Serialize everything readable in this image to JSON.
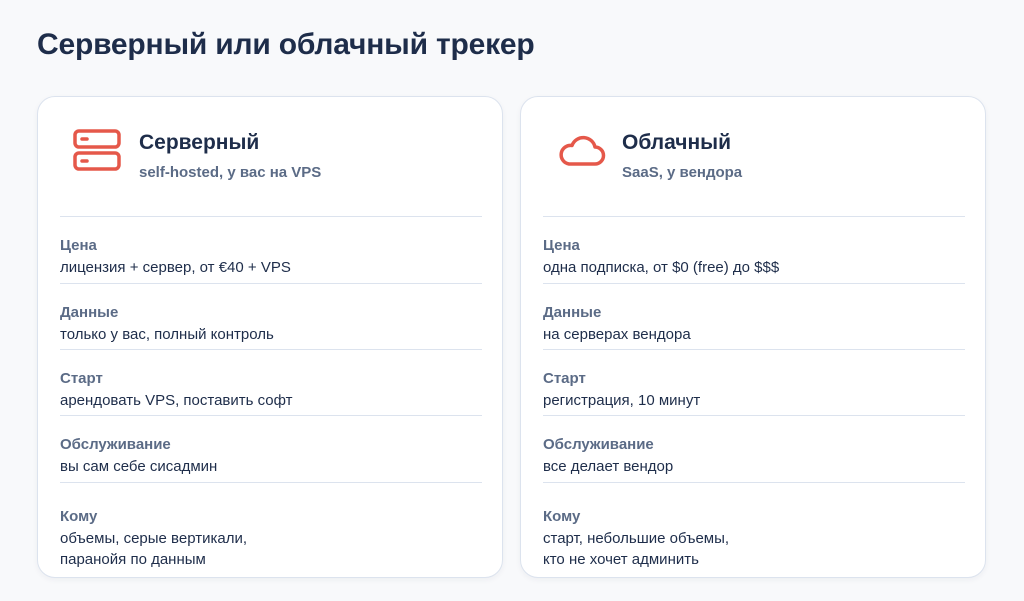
{
  "page": {
    "title": "Серверный или облачный трекер"
  },
  "colors": {
    "accent": "#e5584a",
    "heading": "#1e2d4a",
    "label": "#5b6b86",
    "border": "#dce3ee"
  },
  "cards": [
    {
      "icon": "server-icon",
      "title": "Серверный",
      "subtitle": "self-hosted, у вас на VPS",
      "rows": [
        {
          "label": "Цена",
          "value": "лицензия + сервер, от €40 + VPS"
        },
        {
          "label": "Данные",
          "value": "только у вас, полный контроль"
        },
        {
          "label": "Старт",
          "value": "арендовать VPS, поставить софт"
        },
        {
          "label": "Обслуживание",
          "value": "вы сам себе сисадмин"
        },
        {
          "label": "Кому",
          "value": "объемы, серые вертикали,\nпаранойя по данным"
        }
      ]
    },
    {
      "icon": "cloud-icon",
      "title": "Облачный",
      "subtitle": "SaaS, у вендора",
      "rows": [
        {
          "label": "Цена",
          "value": "одна подписка, от $0 (free) до $$$"
        },
        {
          "label": "Данные",
          "value": "на серверах вендора"
        },
        {
          "label": "Старт",
          "value": "регистрация, 10 минут"
        },
        {
          "label": "Обслуживание",
          "value": "все делает вендор"
        },
        {
          "label": "Кому",
          "value": "старт, небольшие объемы,\nкто не хочет админить"
        }
      ]
    }
  ]
}
